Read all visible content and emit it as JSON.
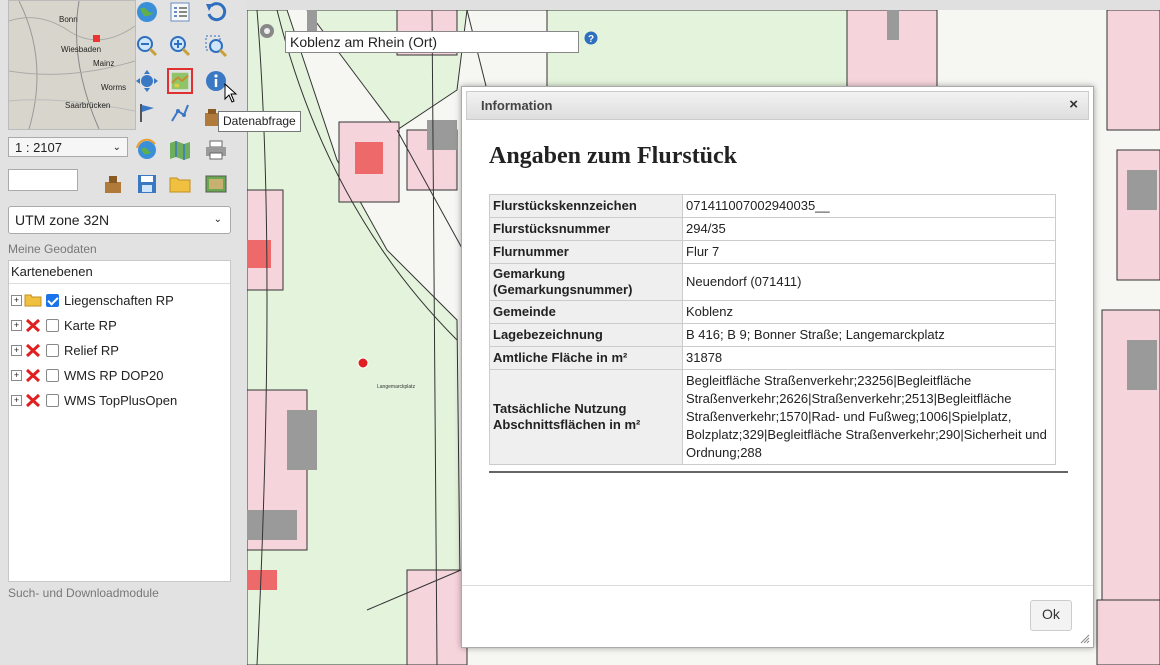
{
  "app": {
    "scale": "1 : 2107",
    "crs": "UTM zone 32N",
    "tooltip": "Datenabfrage"
  },
  "overview_map": {
    "place_labels": [
      "Bonn",
      "Wiesbaden",
      "Mainz",
      "Worms",
      "Saarbrücken"
    ]
  },
  "toolbar": {
    "icons": [
      "globe-icon",
      "legend-icon",
      "back-icon",
      "zoom-out-icon",
      "zoom-in-icon",
      "zoom-extent-icon",
      "move-icon",
      "layer-select-icon",
      "info-icon",
      "flag-icon",
      "measure-icon",
      "bag-icon",
      "refresh-globe-icon",
      "map-icon",
      "print-icon",
      "stamp-icon",
      "save-icon",
      "folder-icon",
      "picture-icon"
    ]
  },
  "sidebar": {
    "geo_header": "Meine Geodaten",
    "panel_title": "Kartenebenen",
    "layers": [
      {
        "label": "Liegenschaften RP",
        "checked": true,
        "icon": "folder-icon"
      },
      {
        "label": "Karte RP",
        "checked": false,
        "icon": "error-x-icon"
      },
      {
        "label": "Relief RP",
        "checked": false,
        "icon": "error-x-icon"
      },
      {
        "label": "WMS RP DOP20",
        "checked": false,
        "icon": "error-x-icon"
      },
      {
        "label": "WMS TopPlusOpen",
        "checked": false,
        "icon": "error-x-icon"
      }
    ],
    "search_header": "Such- und Downloadmodule"
  },
  "map": {
    "search_value": "Koblenz am Rhein (Ort)",
    "marker_label": "Langemarckplatz"
  },
  "dialog": {
    "title": "Information",
    "close": "×",
    "heading": "Angaben zum Flurstück",
    "rows": [
      {
        "key": "Flurstückskennzeichen",
        "value": "071411007002940035__"
      },
      {
        "key": "Flurstücksnummer",
        "value": "294/35"
      },
      {
        "key": "Flurnummer",
        "value": "Flur 7"
      },
      {
        "key": "Gemarkung (Gemarkungsnummer)",
        "value": "Neuendorf (071411)"
      },
      {
        "key": "Gemeinde",
        "value": "Koblenz"
      },
      {
        "key": "Lagebezeichnung",
        "value": "B 416; B 9; Bonner Straße; Langemarckplatz"
      },
      {
        "key": "Amtliche Fläche in m²",
        "value": "31878"
      },
      {
        "key": "Tatsächliche Nutzung Abschnittsflächen in m²",
        "value": "Begleitfläche Straßenverkehr;23256|Begleitfläche Straßenverkehr;2626|Straßenverkehr;2513|Begleitfläche Straßenverkehr;1570|Rad- und Fußweg;1006|Spielplatz, Bolzplatz;329|Begleitfläche Straßenverkehr;290|Sicherheit und Ordnung;288"
      }
    ],
    "ok": "Ok"
  }
}
